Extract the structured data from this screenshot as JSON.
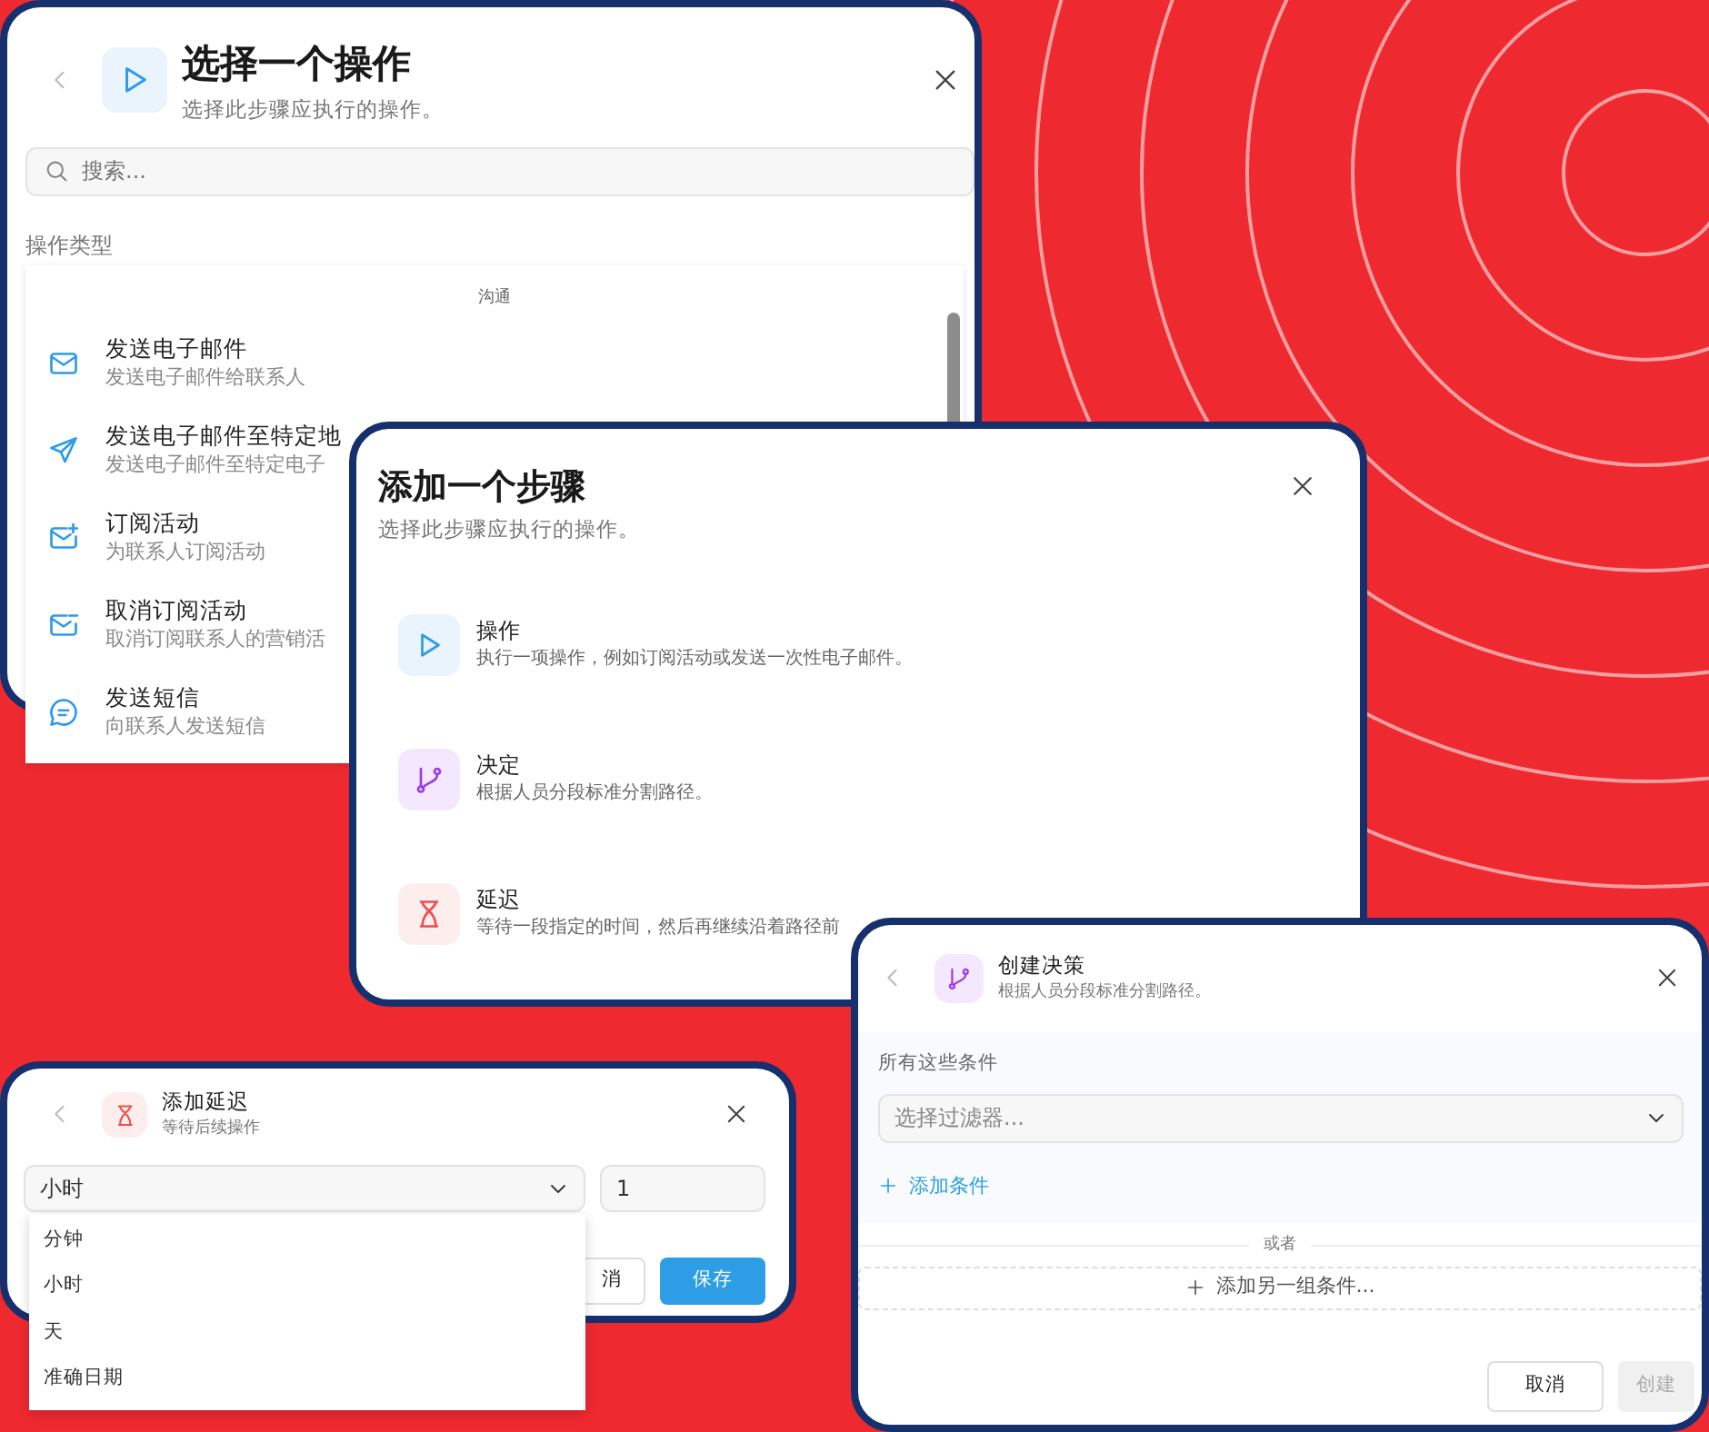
{
  "action_picker": {
    "title": "选择一个操作",
    "subtitle": "选择此步骤应执行的操作。",
    "search": {
      "placeholder": "搜索..."
    },
    "section_label": "操作类型",
    "category": "沟通",
    "items": [
      {
        "kind": "email",
        "title": "发送电子邮件",
        "description": "发送电子邮件给联系人"
      },
      {
        "kind": "send",
        "title": "发送电子邮件至特定地",
        "description": "发送电子邮件至特定电子"
      },
      {
        "kind": "subscribe",
        "title": "订阅活动",
        "description": "为联系人订阅活动"
      },
      {
        "kind": "unsubscribe",
        "title": "取消订阅活动",
        "description": "取消订阅联系人的营销活"
      },
      {
        "kind": "sms",
        "title": "发送短信",
        "description": "向联系人发送短信"
      }
    ]
  },
  "add_step": {
    "title": "添加一个步骤",
    "subtitle": "选择此步骤应执行的操作。",
    "options": [
      {
        "kind": "action",
        "title": "操作",
        "description": "执行一项操作，例如订阅活动或发送一次性电子邮件。"
      },
      {
        "kind": "decision",
        "title": "决定",
        "description": "根据人员分段标准分割路径。"
      },
      {
        "kind": "delay",
        "title": "延迟",
        "description": "等待一段指定的时间，然后再继续沿着路径前"
      }
    ]
  },
  "add_delay": {
    "title": "添加延迟",
    "subtitle": "等待后续操作",
    "unit_select": {
      "value": "小时"
    },
    "amount": {
      "value": "1"
    },
    "unit_options": [
      "分钟",
      "小时",
      "天",
      "准确日期"
    ],
    "cancel_button": "消",
    "save_button": "保存"
  },
  "create_decision": {
    "title": "创建决策",
    "subtitle": "根据人员分段标准分割路径。",
    "group_label": "所有这些条件",
    "filter_select": {
      "placeholder": "选择过滤器..."
    },
    "add_condition": "添加条件",
    "divider_label": "或者",
    "add_group": "添加另一组条件...",
    "cancel_button": "取消",
    "create_button": {
      "label": "创建",
      "disabled": true
    }
  }
}
